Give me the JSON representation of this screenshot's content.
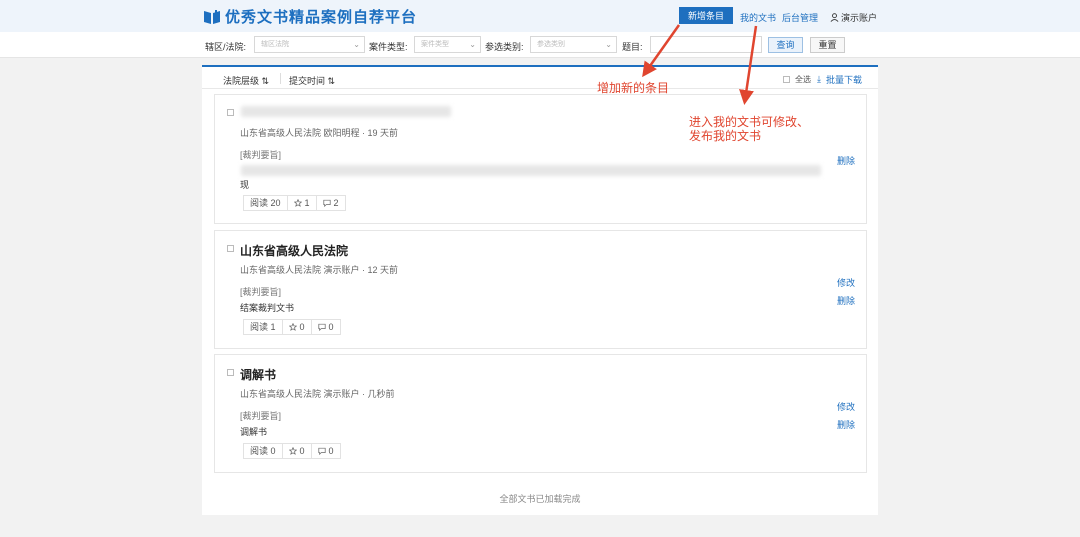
{
  "header": {
    "title": "优秀文书精品案例自荐平台",
    "new_button": "新增条目",
    "my_docs": "我的文书",
    "admin": "后台管理",
    "account": "演示账户"
  },
  "filters": {
    "court_label": "辖区/法院:",
    "court_placeholder": "辖区法院",
    "case_type_label": "案件类型:",
    "case_type_placeholder": "案件类型",
    "category_label": "参选类别:",
    "category_placeholder": "参选类别",
    "topic_label": "题目:",
    "query_button": "查询",
    "reset_button": "重置"
  },
  "sortbar": {
    "sort_court": "法院层级 ⇅",
    "sort_time": "提交时间 ⇅",
    "select_all": "全选",
    "batch_download": "批量下载"
  },
  "cards": [
    {
      "title": "",
      "meta": "山东省高级人民法院 欧阳明程 · 19 天前",
      "label": "[裁判要旨]",
      "summary": "",
      "tail": "现",
      "views": "阅读 20",
      "stars": "1",
      "comments": "2",
      "actions": [
        "删除"
      ]
    },
    {
      "title": "山东省高级人民法院",
      "meta": "山东省高级人民法院 演示账户 · 12 天前",
      "label": "[裁判要旨]",
      "summary": "结案裁判文书",
      "views": "阅读 1",
      "stars": "0",
      "comments": "0",
      "actions": [
        "修改",
        "删除"
      ]
    },
    {
      "title": "调解书",
      "meta": "山东省高级人民法院 演示账户 · 几秒前",
      "label": "[裁判要旨]",
      "summary": "调解书",
      "views": "阅读 0",
      "stars": "0",
      "comments": "0",
      "actions": [
        "修改",
        "删除"
      ]
    }
  ],
  "footer": "全部文书已加载完成",
  "annotations": {
    "add": "增加新的条目",
    "my_docs_line1": "进入我的文书可修改、",
    "my_docs_line2": "发布我的文书",
    "color": "#e0452f"
  },
  "colors": {
    "accent": "#1e6fbf",
    "header_bg": "#eef4fb",
    "page_bg": "#f2f2f2"
  }
}
